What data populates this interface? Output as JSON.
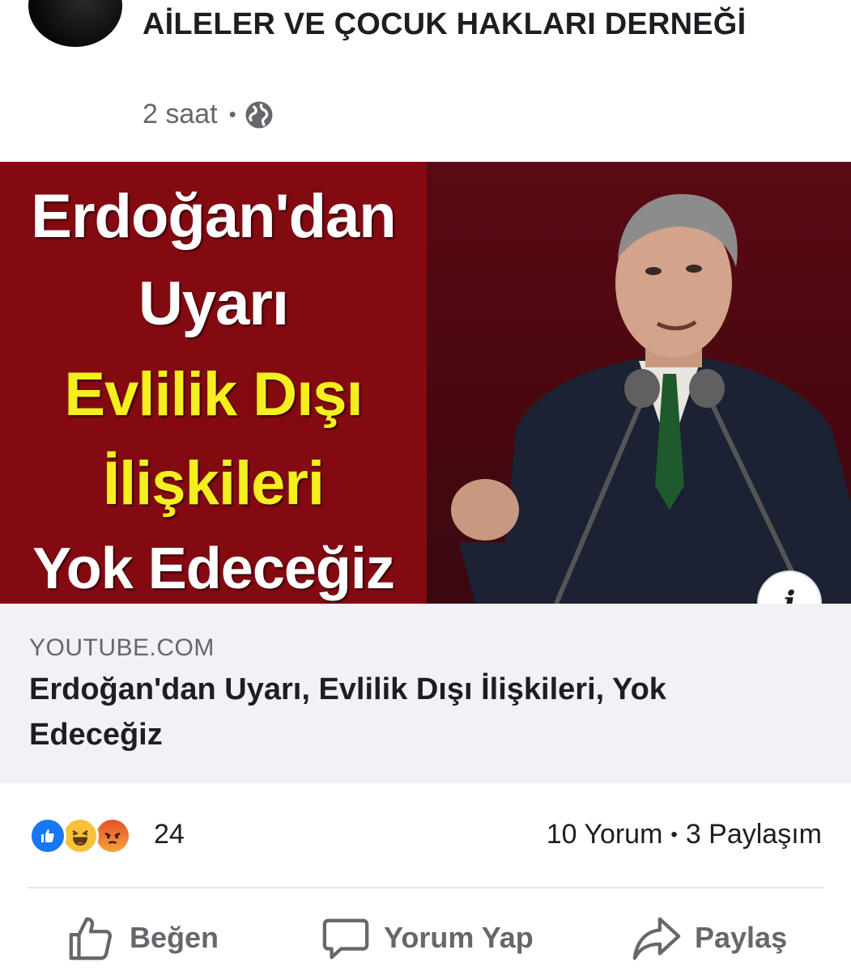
{
  "post": {
    "page_name": "AİLELER VE ÇOCUK HAKLARI DERNEĞİ",
    "time": "2 saat",
    "separator": "•",
    "privacy_icon": "globe-icon"
  },
  "thumbnail": {
    "lines": [
      "Erdoğan'dan",
      "Uyarı",
      "Evlilik Dışı",
      "İlişkileri",
      "Yok Edeceğiz"
    ],
    "colors": {
      "left_bg": "#840a12",
      "white_text": "#ffffff",
      "yellow_text": "#f5ef1e"
    },
    "info_icon": "info-icon",
    "info_label": "i"
  },
  "link": {
    "domain": "YOUTUBE.COM",
    "title": "Erdoğan'dan Uyarı, Evlilik Dışı İlişkileri, Yok Edeceğiz"
  },
  "reactions": {
    "icons": [
      "like-reaction-icon",
      "haha-reaction-icon",
      "angry-reaction-icon"
    ],
    "count": "24",
    "comments": "10 Yorum",
    "separator": "•",
    "shares": "3 Paylaşım"
  },
  "actions": {
    "like": "Beğen",
    "comment": "Yorum Yap",
    "share": "Paylaş"
  },
  "colors": {
    "text_primary": "#1c1e21",
    "text_secondary": "#65676b",
    "link_bg": "#f0f2f5",
    "like_blue": "#1877f2"
  }
}
